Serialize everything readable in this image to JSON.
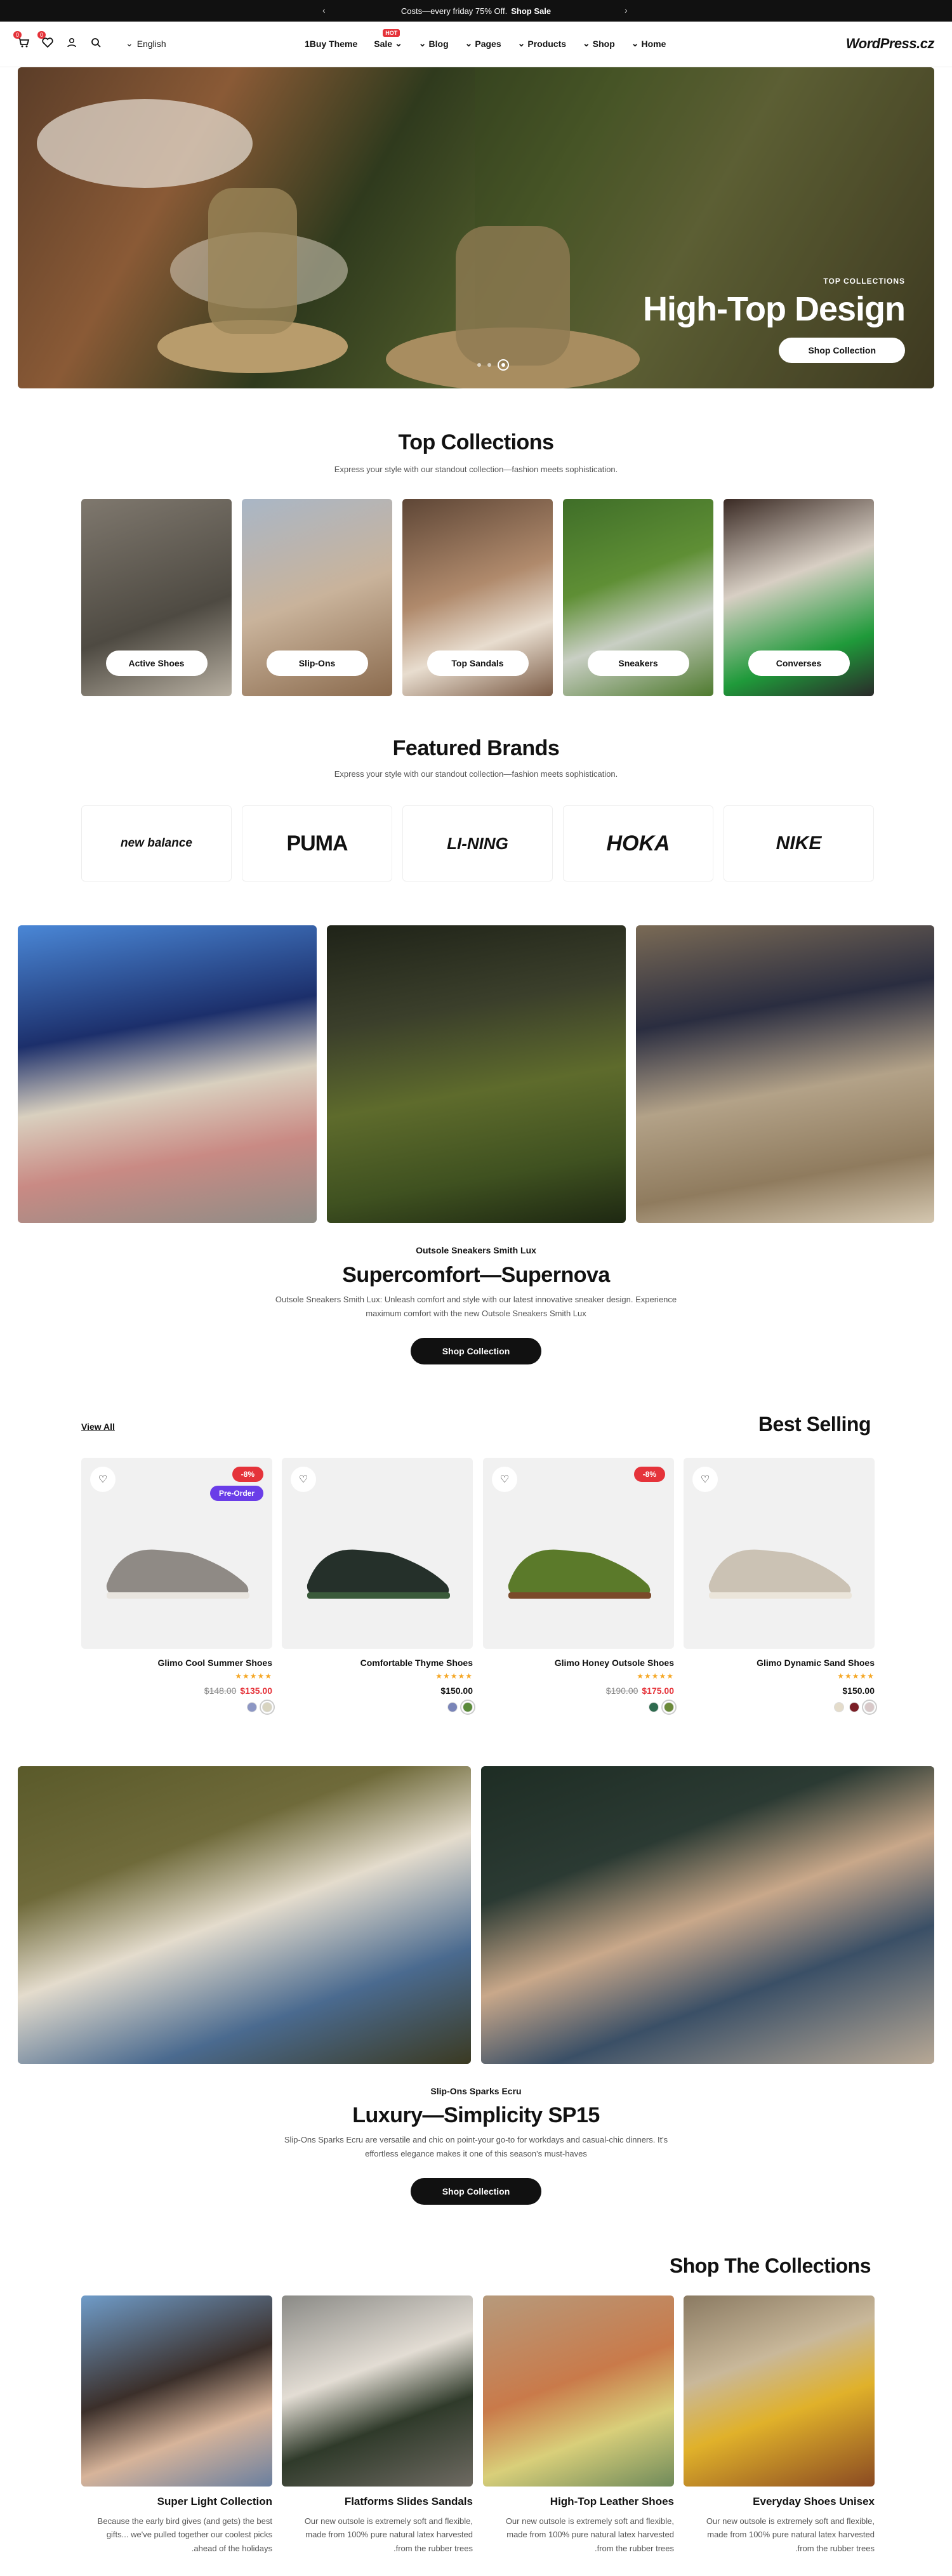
{
  "announcement": {
    "text": "Costs—every friday 75% Off.",
    "link": "Shop Sale",
    "prev": "‹",
    "next": "›"
  },
  "header": {
    "cart_count": "0",
    "wishlist_count": "0",
    "language": "English",
    "nav": [
      {
        "label": "1Buy Theme"
      },
      {
        "label": "Sale",
        "badge": "HOT"
      },
      {
        "label": "Blog"
      },
      {
        "label": "Pages"
      },
      {
        "label": "Products"
      },
      {
        "label": "Shop"
      },
      {
        "label": "Home"
      }
    ],
    "logo": "WordPress.cz"
  },
  "hero": {
    "subtitle": "TOP COLLECTIONS",
    "title": "High-Top Design",
    "button": "Shop Collection"
  },
  "top_collections": {
    "title": "Top Collections",
    "subtitle": "Express your style with our standout collection—fashion meets sophistication.",
    "items": [
      "Active Shoes",
      "Slip-Ons",
      "Top Sandals",
      "Sneakers",
      "Converses"
    ]
  },
  "featured_brands": {
    "title": "Featured Brands",
    "subtitle": "Express your style with our standout collection—fashion meets sophistication.",
    "brands": [
      "new balance",
      "PUMA",
      "LI-NING",
      "HOKA",
      "NIKE"
    ]
  },
  "supernova": {
    "eyebrow": "Outsole Sneakers Smith Lux",
    "title": "Supercomfort—Supernova",
    "desc1": "Outsole Sneakers Smith Lux: Unleash comfort and style with our latest innovative sneaker design. Experience",
    "desc2": "maximum comfort with the new Outsole Sneakers Smith Lux",
    "button": "Shop Collection"
  },
  "best_selling": {
    "title": "Best Selling",
    "view_all": "View All",
    "products": [
      {
        "name": "Glimo Cool Summer Shoes",
        "old_price": "$148.00",
        "price": "$135.00",
        "discount": "-8%",
        "preorder": "Pre-Order",
        "stars": "★★★★★",
        "swatches": [
          "#8d97c4",
          "#d8d4c0"
        ]
      },
      {
        "name": "Comfortable Thyme Shoes",
        "old_price": "",
        "price": "$150.00",
        "discount": "",
        "preorder": "",
        "stars": "★★★★★",
        "swatches": [
          "#7a85b8",
          "#5a8a3a"
        ]
      },
      {
        "name": "Glimo Honey Outsole Shoes",
        "old_price": "$190.00",
        "price": "$175.00",
        "discount": "-8%",
        "preorder": "",
        "stars": "★★★★★",
        "swatches": [
          "#2f6b4f",
          "#6b8a3a"
        ]
      },
      {
        "name": "Glimo Dynamic Sand Shoes",
        "old_price": "",
        "price": "$150.00",
        "discount": "",
        "preorder": "",
        "stars": "★★★★★",
        "swatches": [
          "#e4dccb",
          "#7a1e26",
          "#d8c8c8"
        ]
      }
    ]
  },
  "luxury": {
    "eyebrow": "Slip-Ons Sparks Ecru",
    "title": "Luxury—Simplicity SP15",
    "desc1": "Slip-Ons Sparks Ecru are versatile and chic on point-your go-to for workdays and casual-chic dinners. It's",
    "desc2": "effortless elegance makes it one of this season's must-haves",
    "button": "Shop Collection"
  },
  "shop_collections": {
    "title": "Shop The Collections",
    "items": [
      {
        "title": "Super Light Collection",
        "d1": "Because the early bird gives (and gets) the best",
        "d2": "gifts... we've pulled together our coolest picks",
        "d3": ".ahead of the holidays"
      },
      {
        "title": "Flatforms Slides Sandals",
        "d1": "Our new outsole is extremely soft and flexible,",
        "d2": "made from 100% pure natural latex harvested",
        "d3": ".from the rubber trees"
      },
      {
        "title": "High-Top Leather Shoes",
        "d1": "Our new outsole is extremely soft and flexible,",
        "d2": "made from 100% pure natural latex harvested",
        "d3": ".from the rubber trees"
      },
      {
        "title": "Everyday Shoes Unisex",
        "d1": "Our new outsole is extremely soft and flexible,",
        "d2": "made from 100% pure natural latex harvested",
        "d3": ".from the rubber trees"
      }
    ]
  }
}
